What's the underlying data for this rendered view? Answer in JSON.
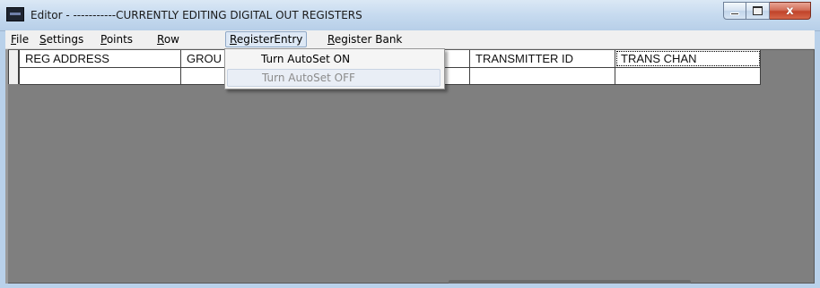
{
  "window": {
    "title": "Editor - -----------CURRENTLY EDITING DIGITAL OUT REGISTERS",
    "close_glyph": "x",
    "icons": [
      "app-icon",
      "minimize-icon",
      "maximize-icon",
      "close-icon"
    ]
  },
  "menu": {
    "items": [
      {
        "label": "File",
        "accel": "F",
        "rest": "ile"
      },
      {
        "label": "Settings",
        "accel": "S",
        "rest": "ettings"
      },
      {
        "label": "Points",
        "accel": "P",
        "rest": "oints"
      },
      {
        "label": "Row",
        "accel": "R",
        "rest": "ow"
      },
      {
        "label": "RegisterEntry",
        "accel": "R",
        "rest": "egisterEntry"
      },
      {
        "label": "Register Bank",
        "accel": "R",
        "rest": "egister Bank"
      }
    ],
    "open_menu": "RegisterEntry"
  },
  "dropdown": {
    "items": [
      {
        "label": "Turn AutoSet ON",
        "enabled": true
      },
      {
        "label": "Turn AutoSet OFF",
        "enabled": false
      }
    ]
  },
  "grid": {
    "headers": [
      "REG ADDRESS",
      "GROU",
      "",
      "TRANSMITTER ID",
      "TRANS CHAN",
      ""
    ],
    "rows": [
      [
        "",
        "",
        "",
        "",
        "",
        ""
      ]
    ]
  },
  "colors": {
    "client_background": "#7f7f7f",
    "titlebar": "#c6daef",
    "close_button": "#c0432a"
  }
}
